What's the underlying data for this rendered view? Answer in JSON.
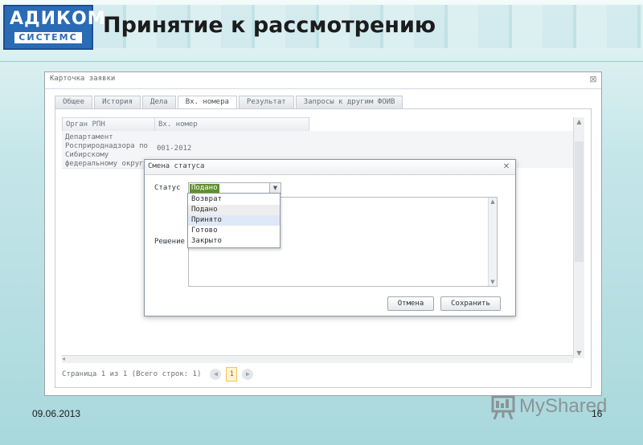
{
  "slide": {
    "title": "Принятие к рассмотрению",
    "logo_top": "АДИКОМ",
    "logo_bottom": "СИСТЕМС",
    "date": "09.06.2013",
    "page_number": "16",
    "watermark": "MyShared"
  },
  "card": {
    "title": "Карточка заявки",
    "tabs": [
      {
        "label": "Общее"
      },
      {
        "label": "История"
      },
      {
        "label": "Дела"
      },
      {
        "label": "Вх. номера"
      },
      {
        "label": "Результат"
      },
      {
        "label": "Запросы к другим ФОИВ"
      }
    ],
    "active_tab": "Вх. номера",
    "grid": {
      "columns": [
        "Орган РПН",
        "Вх. номер"
      ],
      "rows": [
        {
          "organ": "Департамент Росприроднадзора по Сибирскому федеральному округу",
          "number": "001-2012"
        }
      ]
    },
    "pager": {
      "text": "Страница 1 из 1 (Всего строк: 1)",
      "current_page": "1"
    }
  },
  "dialog": {
    "title": "Смена статуса",
    "status_label": "Статус",
    "status_value": "Подано",
    "decision_label": "Решение",
    "options": [
      "Возврат",
      "Подано",
      "Принято",
      "Готово",
      "Закрыто"
    ],
    "selected_option": "Подано",
    "hover_option": "Принято",
    "cancel_label": "Отмена",
    "save_label": "Сохранить"
  },
  "colors": {
    "selected_value_bg": "#5f8f2e",
    "hover_item_bg": "#dfe8f6",
    "logo_blue": "#2a6bb6"
  }
}
